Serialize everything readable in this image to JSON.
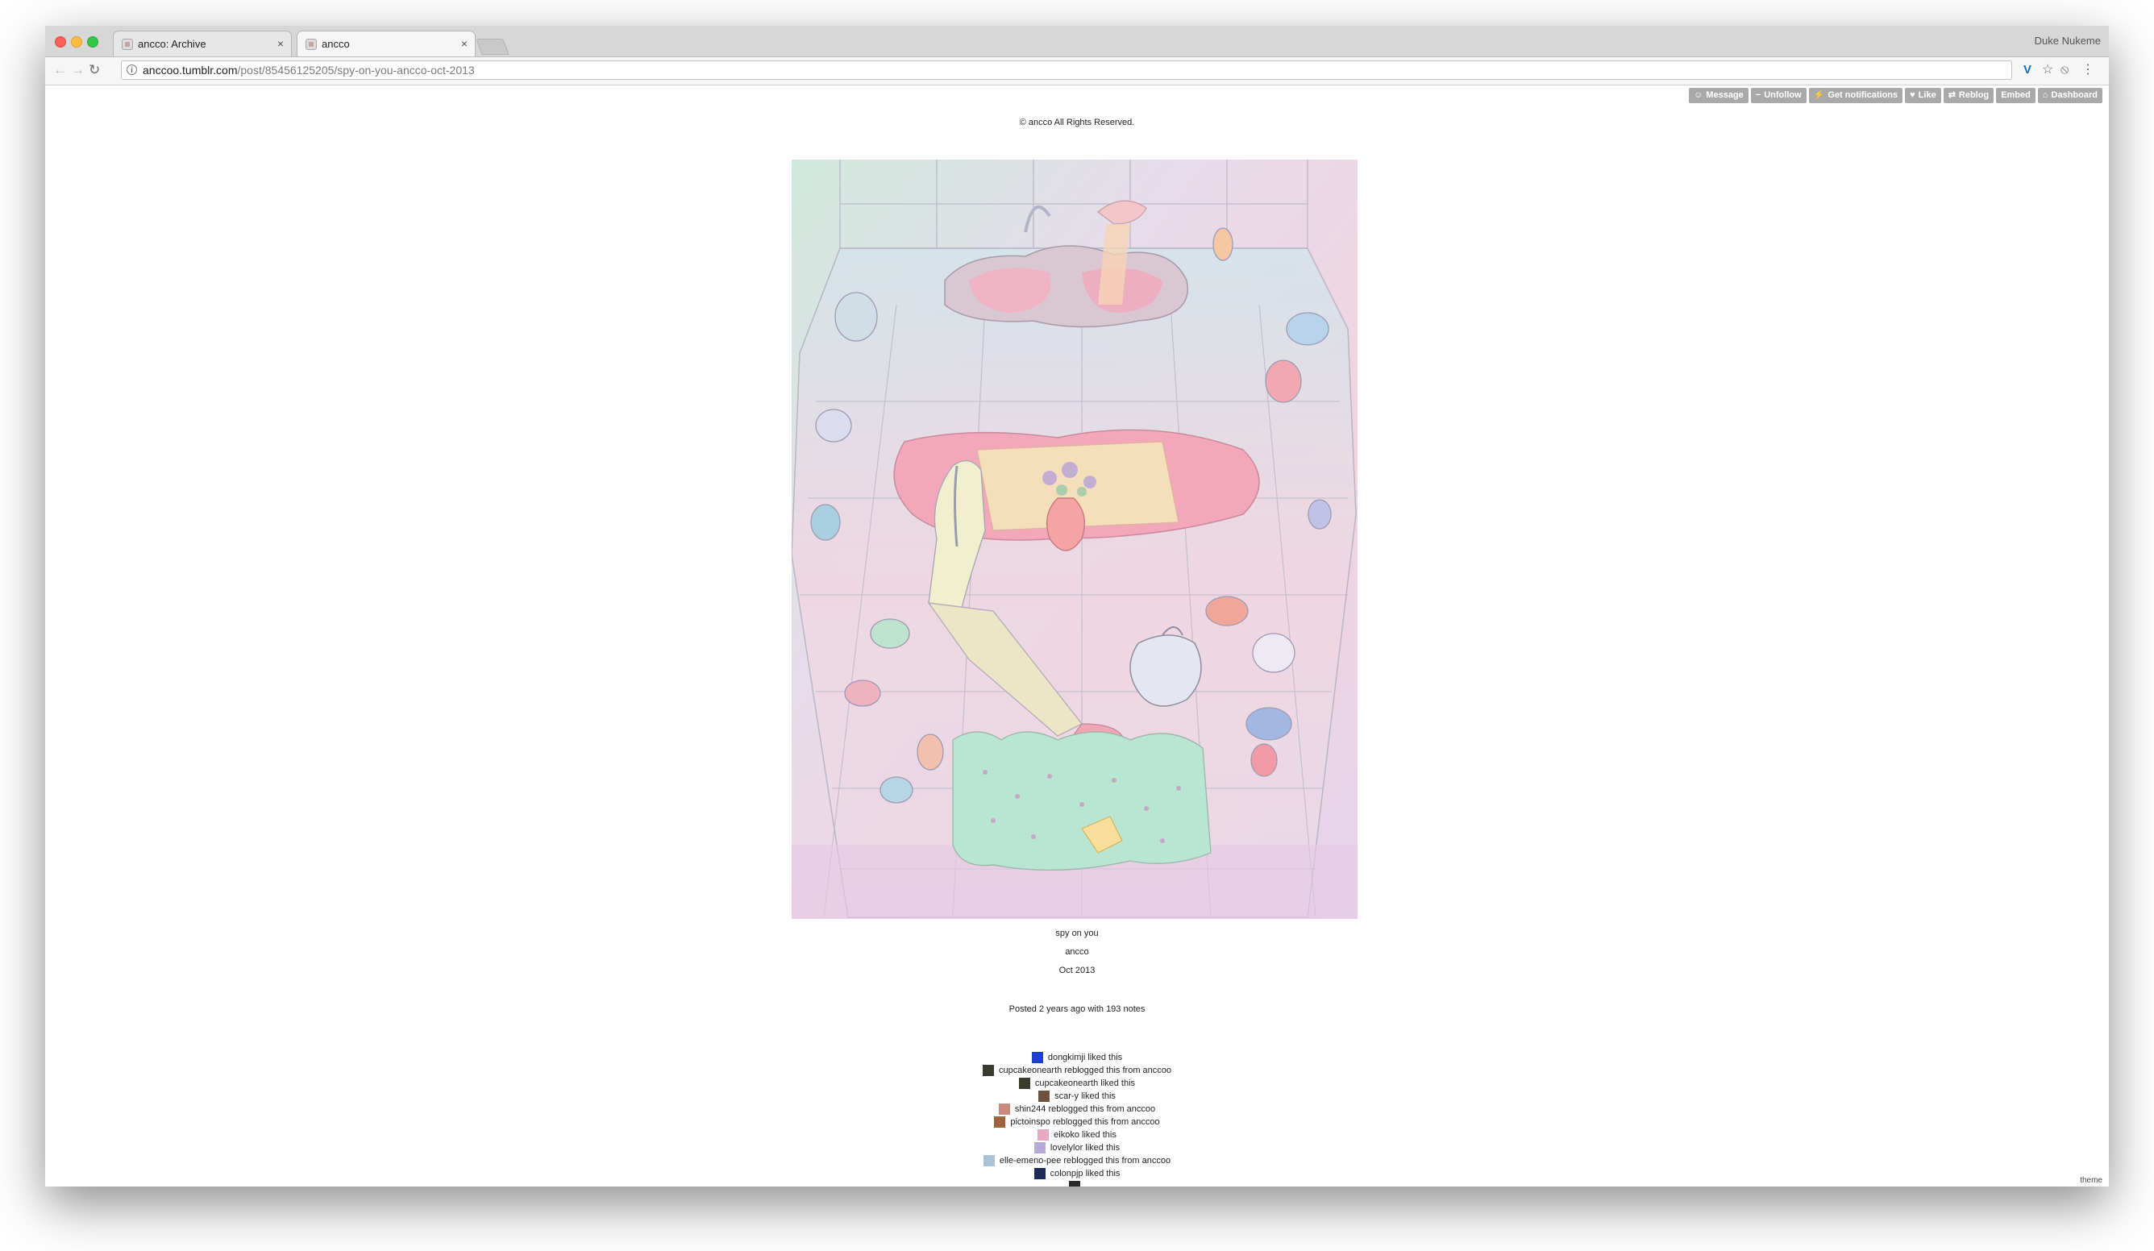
{
  "browser": {
    "tabs": [
      {
        "title": "ancco: Archive",
        "active": false
      },
      {
        "title": "ancco",
        "active": true
      }
    ],
    "profile_name": "Duke Nukeme",
    "url_domain": "anccoo.tumblr.com",
    "url_path": "/post/85456125205/spy-on-you-ancco-oct-2013",
    "close_glyph": "×",
    "icons": {
      "back": "←",
      "forward": "→",
      "reload": "↻",
      "info": "i",
      "extension": "V",
      "bookmark": "☆",
      "blocker": "⦸",
      "menu": "⋮"
    }
  },
  "tumblr_controls": [
    {
      "label": "Message",
      "icon": "☺"
    },
    {
      "label": "Unfollow",
      "icon": "−"
    },
    {
      "label": "Get notifications",
      "icon": "⚡"
    },
    {
      "label": "Like",
      "icon": "♥"
    },
    {
      "label": "Reblog",
      "icon": "⇄"
    },
    {
      "label": "Embed",
      "icon": ""
    },
    {
      "label": "Dashboard",
      "icon": "⌂"
    }
  ],
  "post": {
    "copyright": "© ancco All Rights Reserved.",
    "caption_title": "spy on you",
    "caption_artist": "ancco",
    "caption_date": "Oct 2013",
    "posted": "Posted 2 years ago with 193 notes"
  },
  "notes": [
    {
      "text": "dongkimji liked this",
      "avatar_color": "#1f3fcf"
    },
    {
      "text": "cupcakeonearth reblogged this from anccoo",
      "avatar_color": "#3a3a2e"
    },
    {
      "text": "cupcakeonearth liked this",
      "avatar_color": "#3a3a2e"
    },
    {
      "text": "scar-y liked this",
      "avatar_color": "#6b5240"
    },
    {
      "text": "shin244 reblogged this from anccoo",
      "avatar_color": "#c88a7a"
    },
    {
      "text": "pictoinspo reblogged this from anccoo",
      "avatar_color": "#a0603a"
    },
    {
      "text": "eikoko liked this",
      "avatar_color": "#e6a7c0"
    },
    {
      "text": "lovelylor liked this",
      "avatar_color": "#b7a8d8"
    },
    {
      "text": "elle-emeno-pee reblogged this from anccoo",
      "avatar_color": "#a9c4d8"
    },
    {
      "text": "colonpjp liked this",
      "avatar_color": "#1d2a58"
    },
    {
      "text": "",
      "avatar_color": "#2a2a2a"
    }
  ],
  "footer": {
    "theme_link": "theme"
  }
}
